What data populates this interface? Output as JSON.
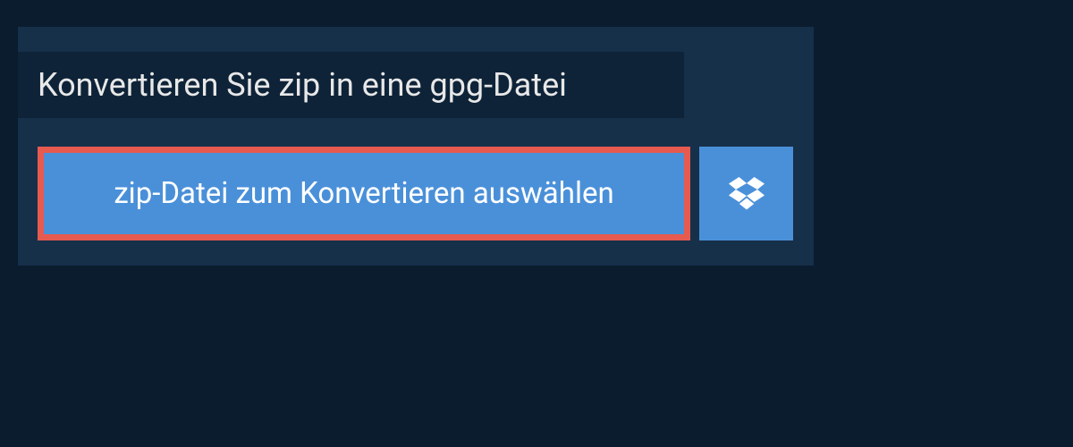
{
  "header": {
    "title": "Konvertieren Sie zip in eine gpg-Datei"
  },
  "actions": {
    "file_select_label": "zip-Datei zum Konvertieren auswählen"
  },
  "colors": {
    "page_bg": "#0a1c2e",
    "panel_bg": "#16304a",
    "title_bg": "#0e2338",
    "button_bg": "#4a90d9",
    "button_border": "#e65a4f"
  }
}
